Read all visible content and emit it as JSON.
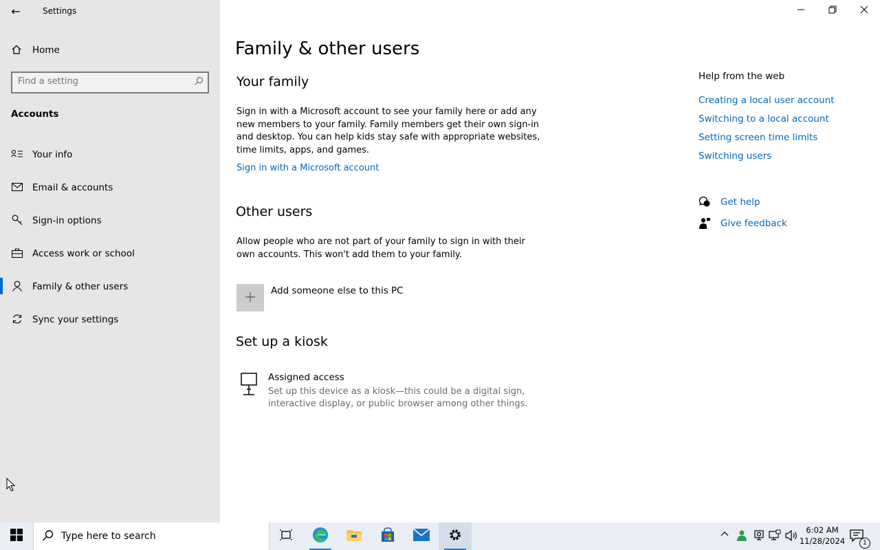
{
  "window": {
    "title": "Settings",
    "back_icon": "back-arrow-icon",
    "minimize_icon": "minimize-icon",
    "restore_icon": "restore-icon",
    "close_icon": "close-icon"
  },
  "sidebar": {
    "home_label": "Home",
    "search_placeholder": "Find a setting",
    "section_title": "Accounts",
    "items": [
      {
        "label": "Your info",
        "icon": "contact-card-icon"
      },
      {
        "label": "Email & accounts",
        "icon": "mail-icon"
      },
      {
        "label": "Sign-in options",
        "icon": "key-icon"
      },
      {
        "label": "Access work or school",
        "icon": "briefcase-icon"
      },
      {
        "label": "Family & other users",
        "icon": "person-icon",
        "selected": true
      },
      {
        "label": "Sync your settings",
        "icon": "sync-icon"
      }
    ]
  },
  "main": {
    "page_title": "Family & other users",
    "your_family": {
      "heading": "Your family",
      "body": "Sign in with a Microsoft account to see your family here or add any new members to your family. Family members get their own sign-in and desktop. You can help kids stay safe with appropriate websites, time limits, apps, and games.",
      "link": "Sign in with a Microsoft account"
    },
    "other_users": {
      "heading": "Other users",
      "body": "Allow people who are not part of your family to sign in with their own accounts. This won't add them to your family.",
      "add_label": "Add someone else to this PC"
    },
    "kiosk": {
      "heading": "Set up a kiosk",
      "title": "Assigned access",
      "description": "Set up this device as a kiosk—this could be a digital sign, interactive display, or public browser among other things."
    }
  },
  "help": {
    "title": "Help from the web",
    "links": [
      "Creating a local user account",
      "Switching to a local account",
      "Setting screen time limits",
      "Switching users"
    ],
    "get_help": "Get help",
    "give_feedback": "Give feedback"
  },
  "taskbar": {
    "search_placeholder": "Type here to search",
    "time": "6:02 AM",
    "date": "11/28/2024",
    "notification_count": "1"
  }
}
